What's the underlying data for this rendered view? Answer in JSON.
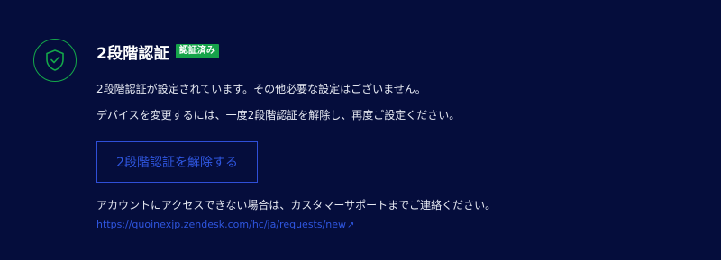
{
  "header": {
    "title": "2段階認証",
    "badge": "認証済み"
  },
  "description": {
    "line1": "2段階認証が設定されています。その他必要な設定はございません。",
    "line2": "デバイスを変更するには、一度2段階認証を解除し、再度ご設定ください。"
  },
  "actions": {
    "disable_label": "2段階認証を解除する"
  },
  "support": {
    "text": "アカウントにアクセスできない場合は、カスタマーサポートまでご連絡ください。",
    "link_text": "https://quoinexjp.zendesk.com/hc/ja/requests/new",
    "link_icon": "external-link-icon"
  },
  "colors": {
    "background": "#050d3c",
    "accent_green": "#16a34a",
    "link_blue": "#2f56e0"
  }
}
